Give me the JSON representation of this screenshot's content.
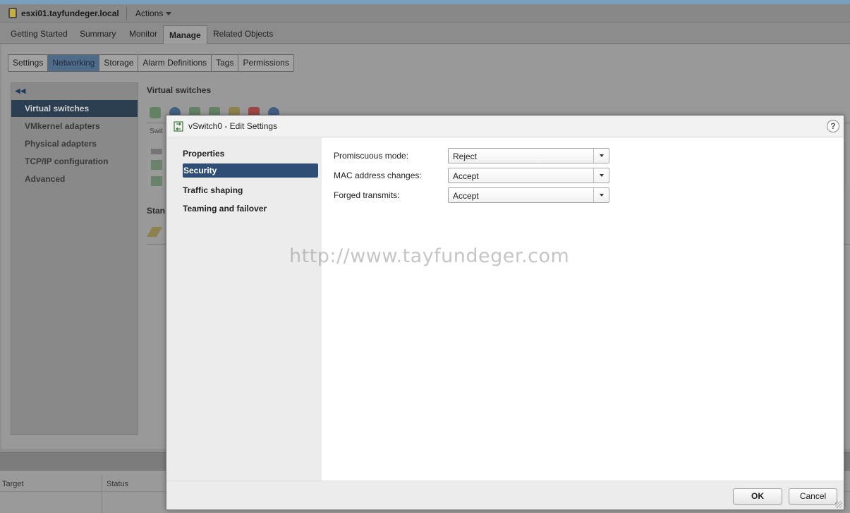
{
  "header": {
    "host_name": "esxi01.tayfundeger.local",
    "actions_label": "Actions"
  },
  "main_tabs": [
    {
      "label": "Getting Started"
    },
    {
      "label": "Summary"
    },
    {
      "label": "Monitor"
    },
    {
      "label": "Manage",
      "active": true
    },
    {
      "label": "Related Objects"
    }
  ],
  "sub_tabs": [
    {
      "label": "Settings"
    },
    {
      "label": "Networking",
      "active": true
    },
    {
      "label": "Storage"
    },
    {
      "label": "Alarm Definitions"
    },
    {
      "label": "Tags"
    },
    {
      "label": "Permissions"
    }
  ],
  "left_nav": [
    {
      "label": "Virtual switches",
      "active": true
    },
    {
      "label": "VMkernel adapters"
    },
    {
      "label": "Physical adapters"
    },
    {
      "label": "TCP/IP configuration"
    },
    {
      "label": "Advanced"
    }
  ],
  "background": {
    "section_title": "Virtual switches",
    "table_header_fragment": "Swit",
    "standard_fragment": "Stan",
    "bottom_columns": [
      "Target",
      "Status"
    ]
  },
  "dialog": {
    "title": "vSwitch0 - Edit Settings",
    "help_label": "?",
    "nav": [
      {
        "label": "Properties"
      },
      {
        "label": "Security",
        "active": true
      },
      {
        "label": "Traffic shaping"
      },
      {
        "label": "Teaming and failover"
      }
    ],
    "fields": [
      {
        "label": "Promiscuous mode:",
        "value": "Reject"
      },
      {
        "label": "MAC address changes:",
        "value": "Accept"
      },
      {
        "label": "Forged transmits:",
        "value": "Accept"
      }
    ],
    "watermark": "http://www.tayfundeger.com",
    "ok_label": "OK",
    "cancel_label": "Cancel"
  },
  "colors": {
    "selection_blue": "#2e4e75",
    "dialog_bg": "#ffffff",
    "dialog_sidebar_bg": "#ececec"
  }
}
